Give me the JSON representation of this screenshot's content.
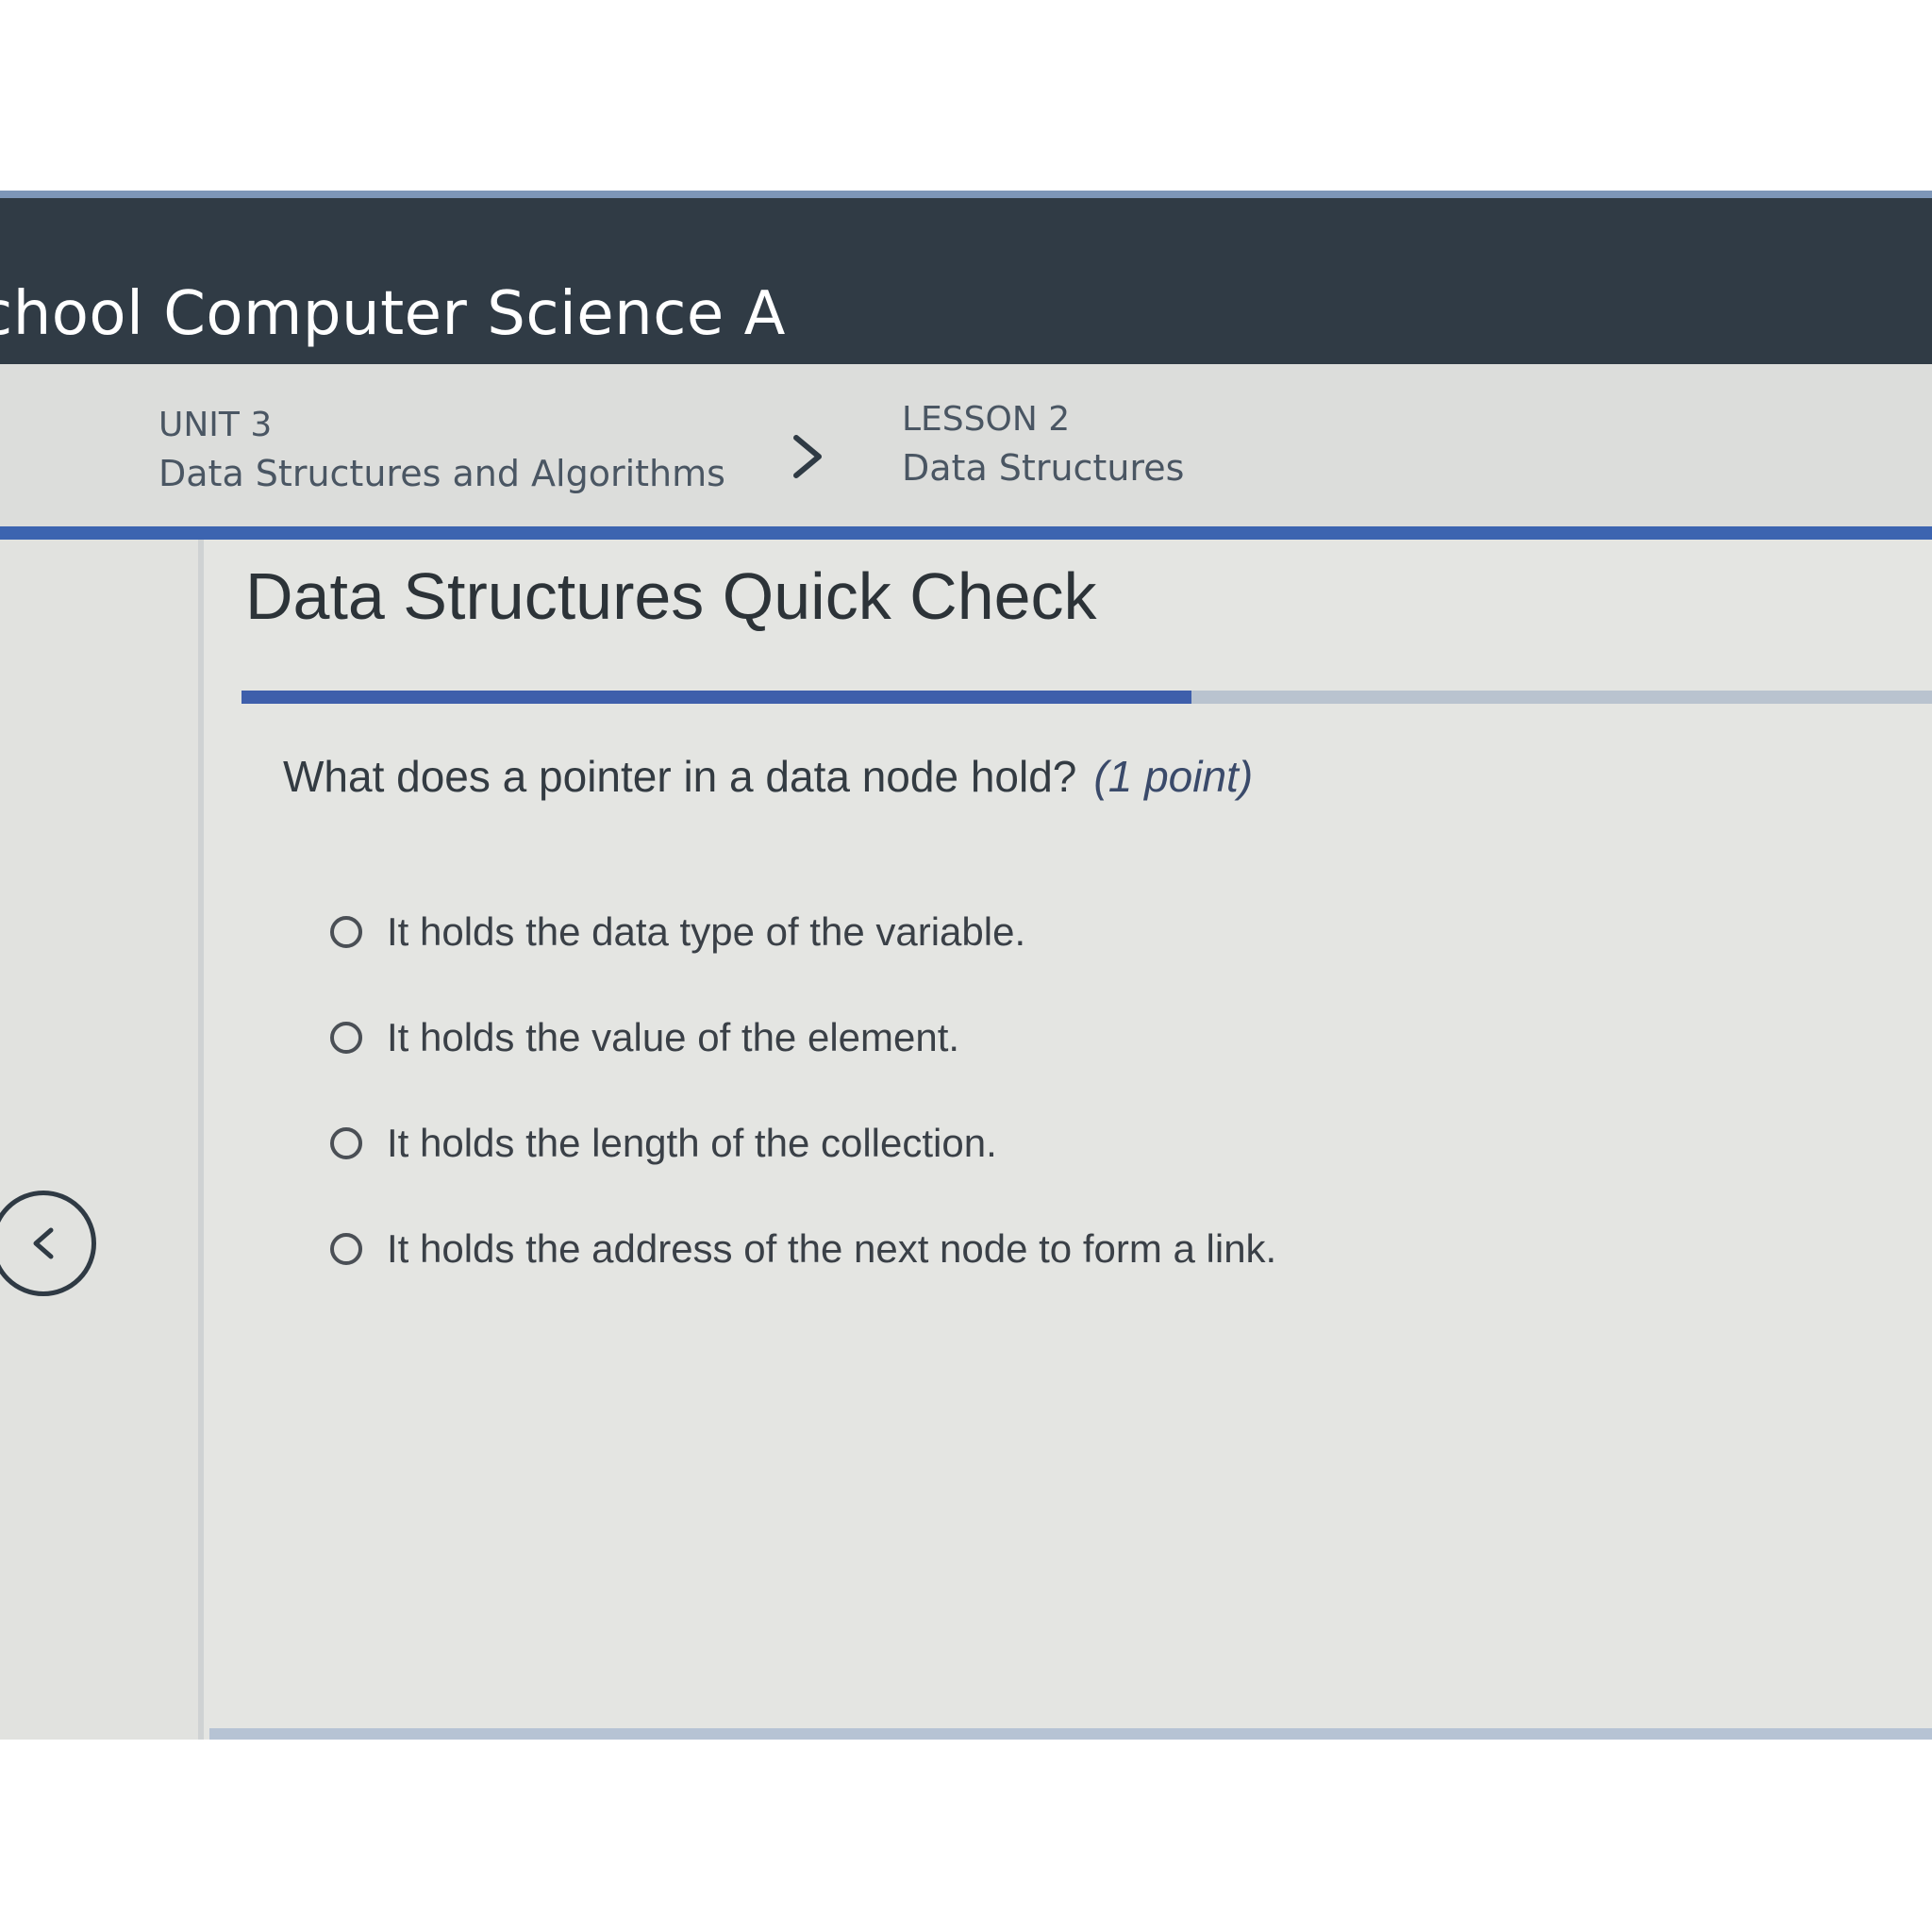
{
  "header": {
    "course_title": "chool Computer Science A"
  },
  "breadcrumb": {
    "unit_label": "UNIT 3",
    "unit_name": "Data Structures and Algorithms",
    "separator_icon": "chevron-right-icon",
    "lesson_label": "LESSON 2",
    "lesson_name": "Data Structures"
  },
  "quiz": {
    "title": "Data Structures Quick Check",
    "progress_fraction": 0.56,
    "question": "What does a pointer in a data node hold?",
    "points": "(1 point)",
    "options": [
      "It holds the data type of the variable.",
      "It holds the value of the element.",
      "It holds the length of the collection.",
      "It holds the address of the next node to form a link."
    ]
  },
  "nav": {
    "back_icon": "chevron-left-icon"
  },
  "colors": {
    "header_bg": "#303b45",
    "accent_blue": "#3c64b0",
    "page_bg": "#e1e2df"
  }
}
